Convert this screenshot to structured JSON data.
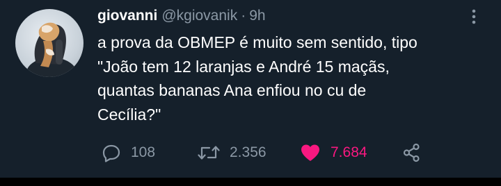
{
  "author": {
    "display_name": "giovanni",
    "handle": "@kgiovanik",
    "separator": "·",
    "time": "9h"
  },
  "tweet": {
    "lines": [
      "a prova da OBMEP é muito sem sentido, tipo",
      "\"João tem 12 laranjas e André 15 maçãs,",
      "quantas bananas Ana enfiou no cu de",
      "Cecília?\""
    ]
  },
  "actions": {
    "replies": "108",
    "retweets": "2.356",
    "likes": "7.684"
  },
  "colors": {
    "background": "#15202b",
    "secondary_text": "#8b98a5",
    "like_active": "#f91880"
  },
  "icons": [
    "more-options-icon",
    "reply-icon",
    "retweet-icon",
    "like-icon",
    "share-icon"
  ]
}
